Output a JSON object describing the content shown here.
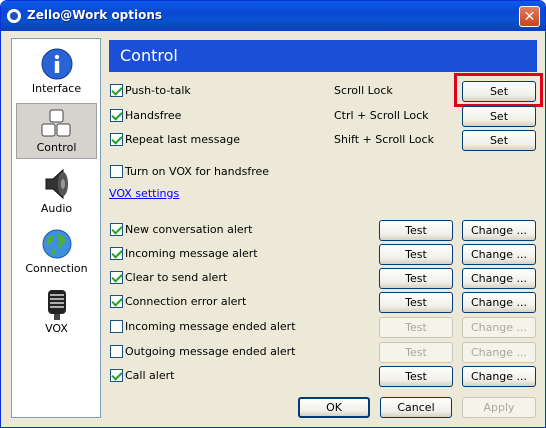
{
  "window": {
    "title": "Zello@Work options",
    "close": "✕"
  },
  "sidebar": {
    "items": [
      {
        "label": "Interface",
        "icon": "info-icon"
      },
      {
        "label": "Control",
        "icon": "keyboard-keys-icon"
      },
      {
        "label": "Audio",
        "icon": "speaker-icon"
      },
      {
        "label": "Connection",
        "icon": "globe-icon"
      },
      {
        "label": "VOX",
        "icon": "microphone-icon"
      }
    ],
    "active": "Control"
  },
  "header": {
    "title": "Control"
  },
  "hotkeys": [
    {
      "label": "Push-to-talk",
      "checked": true,
      "key": "Scroll Lock",
      "button": "Set"
    },
    {
      "label": "Handsfree",
      "checked": true,
      "key": "Ctrl + Scroll Lock",
      "button": "Set"
    },
    {
      "label": "Repeat last message",
      "checked": true,
      "key": "Shift + Scroll Lock",
      "button": "Set"
    }
  ],
  "vox": {
    "label": "Turn on VOX for handsfree",
    "checked": false,
    "link": "VOX settings"
  },
  "alerts": [
    {
      "label": "New conversation alert",
      "checked": true,
      "test": "Test",
      "change": "Change ...",
      "enabled": true
    },
    {
      "label": "Incoming message alert",
      "checked": true,
      "test": "Test",
      "change": "Change ...",
      "enabled": true
    },
    {
      "label": "Clear to send alert",
      "checked": true,
      "test": "Test",
      "change": "Change ...",
      "enabled": true
    },
    {
      "label": "Connection error alert",
      "checked": true,
      "test": "Test",
      "change": "Change ...",
      "enabled": true
    },
    {
      "label": "Incoming message ended alert",
      "checked": false,
      "test": "Test",
      "change": "Change ...",
      "enabled": false
    },
    {
      "label": "Outgoing message ended alert",
      "checked": false,
      "test": "Test",
      "change": "Change ...",
      "enabled": false
    },
    {
      "label": "Call alert",
      "checked": true,
      "test": "Test",
      "change": "Change ...",
      "enabled": true
    }
  ],
  "footer": {
    "ok": "OK",
    "cancel": "Cancel",
    "apply": "Apply"
  },
  "colors": {
    "header_bg": "#1b4fd8",
    "highlight": "#e1001a",
    "titlebar": "#0b46d4"
  }
}
